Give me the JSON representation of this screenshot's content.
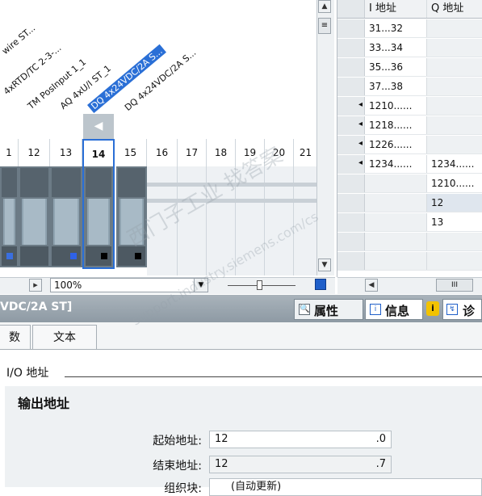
{
  "device_view": {
    "module_labels": [
      "wire ST...",
      "4xRTD/TC 2-3-...",
      "TM PosInput 1_1",
      "AQ 4xU/I ST_1",
      "DQ 4x24VDC/2A S...",
      "DQ 4x24VDC/2A S..."
    ],
    "selected_module_index": 4,
    "slots": [
      "1",
      "12",
      "13",
      "14",
      "15",
      "16",
      "17",
      "18",
      "19",
      "20",
      "21"
    ],
    "selected_slot": "14",
    "collapse_arrow": "◀",
    "zoom_value": "100%",
    "scroll_right_arrow": "▸"
  },
  "address_table": {
    "columns": [
      "I 地址",
      "Q 地址"
    ],
    "rows": [
      {
        "i": "31...32",
        "q": ""
      },
      {
        "i": "33...34",
        "q": ""
      },
      {
        "i": "35...36",
        "q": ""
      },
      {
        "i": "37...38",
        "q": ""
      },
      {
        "i": "1210......",
        "q": ""
      },
      {
        "i": "1218......",
        "q": ""
      },
      {
        "i": "1226......",
        "q": ""
      },
      {
        "i": "1234......",
        "q": "1234......"
      },
      {
        "i": "",
        "q": "1210......"
      },
      {
        "i": "",
        "q": "12"
      },
      {
        "i": "",
        "q": "13"
      },
      {
        "i": "",
        "q": ""
      },
      {
        "i": "",
        "q": ""
      }
    ],
    "selected_row_index": 9,
    "hscroll_thumb": "III"
  },
  "inspector": {
    "title": "VDC/2A ST]",
    "tabs": {
      "properties": "属性",
      "info": "信息",
      "diagnostics": "诊"
    },
    "subtabs": [
      "数",
      "文本"
    ],
    "section_io": "I/O 地址",
    "group_output": "输出地址",
    "start_label": "起始地址:",
    "start_value": "12",
    "start_bit": ".0",
    "end_label": "结束地址:",
    "end_value": "12",
    "end_bit": ".7",
    "org_label": "组织块:",
    "org_value": "(自动更新)"
  },
  "watermark": {
    "line1": "西门子工业 找答案",
    "line2": "support.industry.siemens.com/cs"
  }
}
